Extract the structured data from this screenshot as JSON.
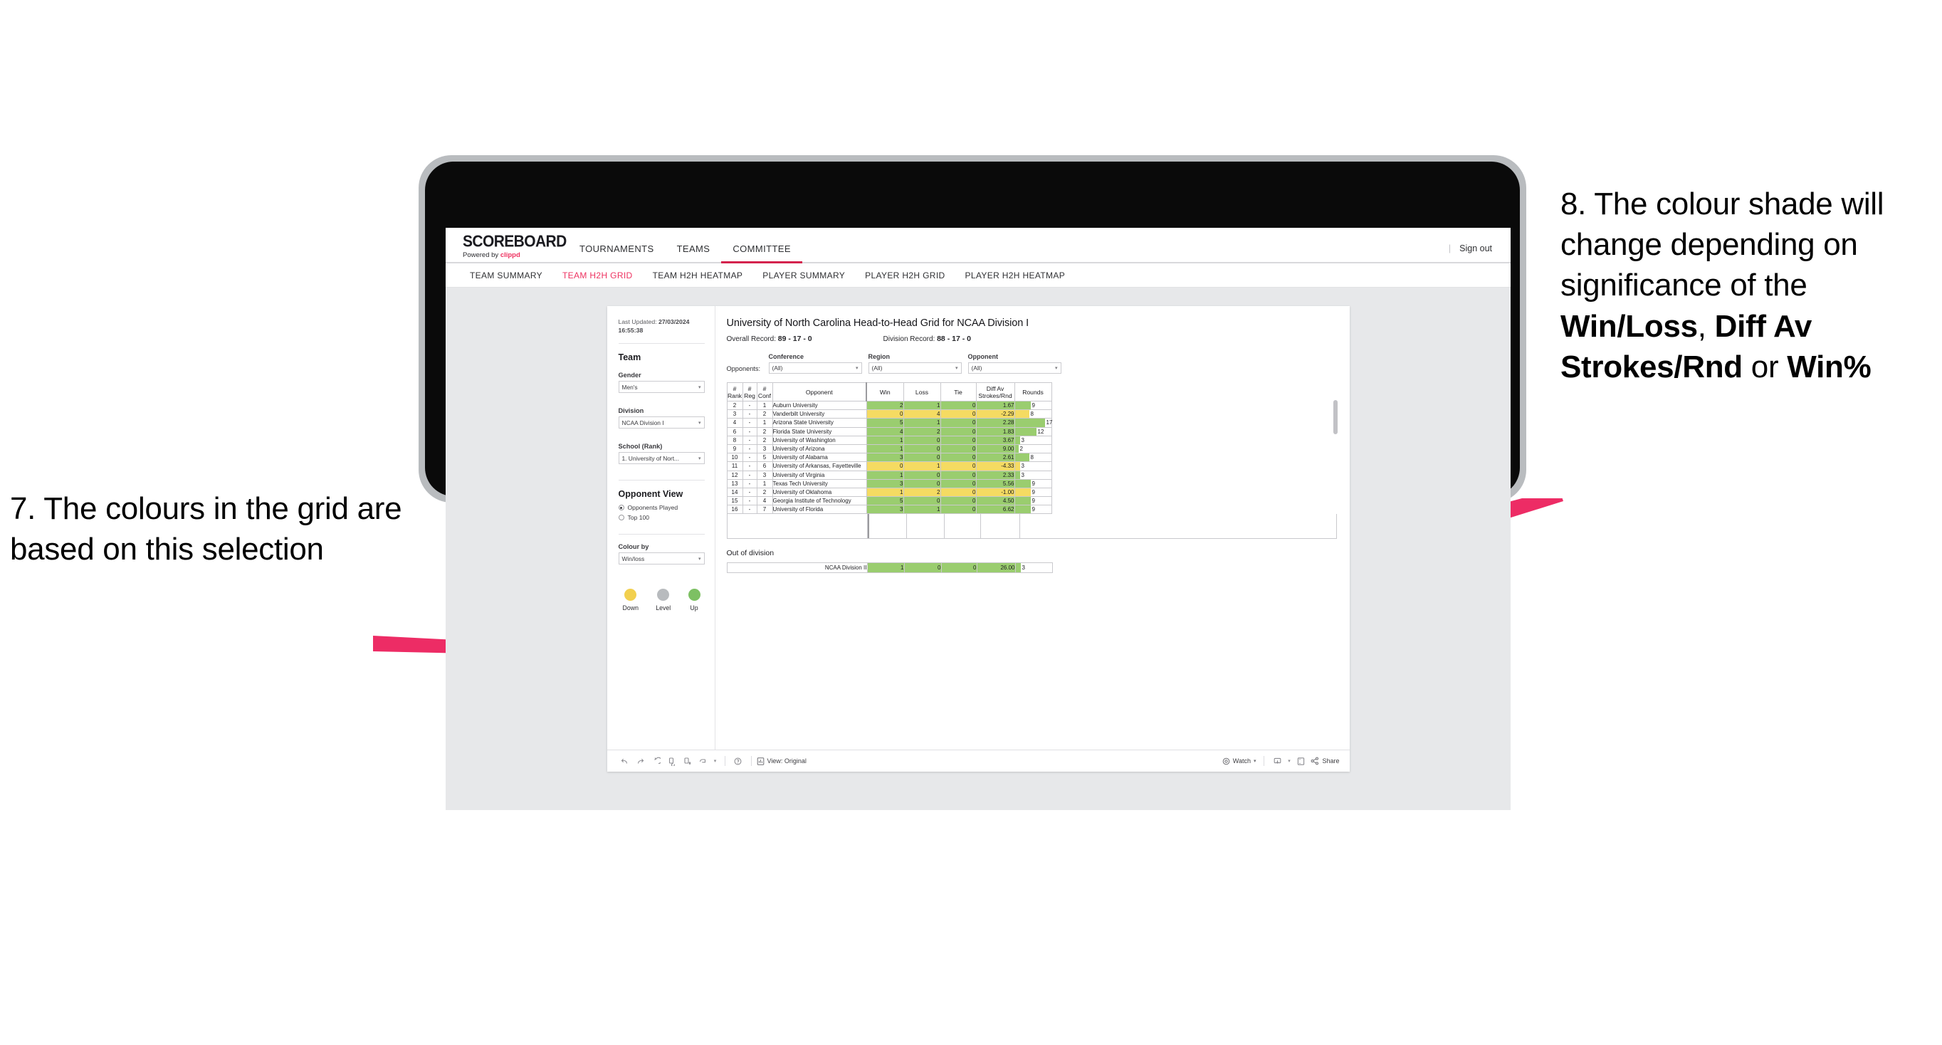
{
  "annotations": {
    "left": "7. The colours in the grid are based on this selection",
    "right_pre": "8. The colour shade will change depending on significance of the ",
    "right_b1": "Win/Loss",
    "right_mid1": ", ",
    "right_b2": "Diff Av Strokes/Rnd",
    "right_mid2": " or ",
    "right_b3": "Win%",
    "arrow_color": "#ED2C65"
  },
  "app": {
    "brand": {
      "word": "SCOREBOARD",
      "sub_pre": "Powered by ",
      "sub_brand": "clippd"
    },
    "main_nav": [
      {
        "label": "TOURNAMENTS",
        "active": false
      },
      {
        "label": "TEAMS",
        "active": false
      },
      {
        "label": "COMMITTEE",
        "active": true
      }
    ],
    "sign_out": "Sign out",
    "sub_nav": [
      {
        "label": "TEAM SUMMARY",
        "active": false
      },
      {
        "label": "TEAM H2H GRID",
        "active": true
      },
      {
        "label": "TEAM H2H HEATMAP",
        "active": false
      },
      {
        "label": "PLAYER SUMMARY",
        "active": false
      },
      {
        "label": "PLAYER H2H GRID",
        "active": false
      },
      {
        "label": "PLAYER H2H HEATMAP",
        "active": false
      }
    ]
  },
  "panel": {
    "last_updated_label": "Last Updated:",
    "last_updated_value": "27/03/2024 16:55:38",
    "team_section": "Team",
    "gender_label": "Gender",
    "gender_value": "Men's",
    "division_label": "Division",
    "division_value": "NCAA Division I",
    "school_label": "School (Rank)",
    "school_value": "1. University of Nort...",
    "opponent_view_title": "Opponent View",
    "opponent_view_options": [
      {
        "label": "Opponents Played",
        "selected": true
      },
      {
        "label": "Top 100",
        "selected": false
      }
    ],
    "colour_by_label": "Colour by",
    "colour_by_value": "Win/loss",
    "legend": [
      {
        "label": "Down",
        "color": "#F2D04F"
      },
      {
        "label": "Level",
        "color": "#B8BBBE"
      },
      {
        "label": "Up",
        "color": "#7DC063"
      }
    ]
  },
  "viz": {
    "title": "University of North Carolina Head-to-Head Grid for NCAA Division I",
    "overall_record_label": "Overall Record: ",
    "overall_record_value": "89 - 17 - 0",
    "division_record_label": "Division Record: ",
    "division_record_value": "88 - 17 - 0",
    "opponents_label": "Opponents:",
    "filters": [
      {
        "label": "Conference",
        "value": "(All)"
      },
      {
        "label": "Region",
        "value": "(All)"
      },
      {
        "label": "Opponent",
        "value": "(All)"
      }
    ],
    "out_of_division_title": "Out of division"
  },
  "chart_data": {
    "type": "table",
    "title": "University of North Carolina Head-to-Head Grid for NCAA Division I",
    "columns": [
      "# Rank",
      "# Reg",
      "# Conf",
      "Opponent",
      "Win",
      "Loss",
      "Tie",
      "Diff Av Strokes/Rnd",
      "Rounds"
    ],
    "column_lines": [
      [
        "#",
        "Rank"
      ],
      [
        "#",
        "Reg"
      ],
      [
        "#",
        "Conf"
      ],
      [
        "",
        "Opponent"
      ],
      [
        "",
        "Win"
      ],
      [
        "",
        "Loss"
      ],
      [
        "",
        "Tie"
      ],
      [
        "Diff Av",
        "Strokes/Rnd"
      ],
      [
        "",
        "Rounds"
      ]
    ],
    "rounds_max": 17,
    "colors": {
      "up": "#9ACD6F",
      "down": "#F5DB62",
      "level": "#B8BBBE"
    },
    "rows": [
      {
        "rank": "2",
        "reg": "-",
        "conf": "1",
        "opponent": "Auburn University",
        "win": "2",
        "loss": "1",
        "tie": "0",
        "diff": "1.67",
        "rounds": "9",
        "rounds_n": 9,
        "state": "up"
      },
      {
        "rank": "3",
        "reg": "-",
        "conf": "2",
        "opponent": "Vanderbilt University",
        "win": "0",
        "loss": "4",
        "tie": "0",
        "diff": "-2.29",
        "rounds": "8",
        "rounds_n": 8,
        "state": "down"
      },
      {
        "rank": "4",
        "reg": "-",
        "conf": "1",
        "opponent": "Arizona State University",
        "win": "5",
        "loss": "1",
        "tie": "0",
        "diff": "2.28",
        "rounds": "17",
        "rounds_n": 17,
        "state": "up"
      },
      {
        "rank": "6",
        "reg": "-",
        "conf": "2",
        "opponent": "Florida State University",
        "win": "4",
        "loss": "2",
        "tie": "0",
        "diff": "1.83",
        "rounds": "12",
        "rounds_n": 12,
        "state": "up"
      },
      {
        "rank": "8",
        "reg": "-",
        "conf": "2",
        "opponent": "University of Washington",
        "win": "1",
        "loss": "0",
        "tie": "0",
        "diff": "3.67",
        "rounds": "3",
        "rounds_n": 3,
        "state": "up"
      },
      {
        "rank": "9",
        "reg": "-",
        "conf": "3",
        "opponent": "University of Arizona",
        "win": "1",
        "loss": "0",
        "tie": "0",
        "diff": "9.00",
        "rounds": "2",
        "rounds_n": 2,
        "state": "up"
      },
      {
        "rank": "10",
        "reg": "-",
        "conf": "5",
        "opponent": "University of Alabama",
        "win": "3",
        "loss": "0",
        "tie": "0",
        "diff": "2.61",
        "rounds": "8",
        "rounds_n": 8,
        "state": "up"
      },
      {
        "rank": "11",
        "reg": "-",
        "conf": "6",
        "opponent": "University of Arkansas, Fayetteville",
        "win": "0",
        "loss": "1",
        "tie": "0",
        "diff": "-4.33",
        "rounds": "3",
        "rounds_n": 3,
        "state": "down"
      },
      {
        "rank": "12",
        "reg": "-",
        "conf": "3",
        "opponent": "University of Virginia",
        "win": "1",
        "loss": "0",
        "tie": "0",
        "diff": "2.33",
        "rounds": "3",
        "rounds_n": 3,
        "state": "up"
      },
      {
        "rank": "13",
        "reg": "-",
        "conf": "1",
        "opponent": "Texas Tech University",
        "win": "3",
        "loss": "0",
        "tie": "0",
        "diff": "5.56",
        "rounds": "9",
        "rounds_n": 9,
        "state": "up"
      },
      {
        "rank": "14",
        "reg": "-",
        "conf": "2",
        "opponent": "University of Oklahoma",
        "win": "1",
        "loss": "2",
        "tie": "0",
        "diff": "-1.00",
        "rounds": "9",
        "rounds_n": 9,
        "state": "down"
      },
      {
        "rank": "15",
        "reg": "-",
        "conf": "4",
        "opponent": "Georgia Institute of Technology",
        "win": "5",
        "loss": "0",
        "tie": "0",
        "diff": "4.50",
        "rounds": "9",
        "rounds_n": 9,
        "state": "up"
      },
      {
        "rank": "16",
        "reg": "-",
        "conf": "7",
        "opponent": "University of Florida",
        "win": "3",
        "loss": "1",
        "tie": "0",
        "diff": "6.62",
        "rounds": "9",
        "rounds_n": 9,
        "state": "up"
      }
    ],
    "out_of_division_rows": [
      {
        "label": "NCAA Division II",
        "win": "1",
        "loss": "0",
        "tie": "0",
        "diff": "26.00",
        "rounds": "3",
        "rounds_n": 3,
        "state": "up"
      }
    ]
  },
  "toolbar": {
    "view_label": "View: Original",
    "watch_label": "Watch",
    "share_label": "Share"
  }
}
